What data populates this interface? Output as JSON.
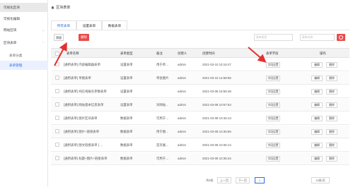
{
  "sidebar": {
    "items": [
      {
        "label": "可视化区块",
        "chevron": "",
        "type": "top",
        "state": "highlight"
      },
      {
        "label": "可视化编辑",
        "chevron": "",
        "type": "top",
        "state": ""
      },
      {
        "label": "网站区块",
        "chevron": "⌄",
        "type": "top",
        "state": ""
      },
      {
        "label": "区块表单",
        "chevron": "⌃",
        "type": "top",
        "state": ""
      },
      {
        "label": "表单分类",
        "chevron": "",
        "type": "sub",
        "state": ""
      },
      {
        "label": "表单管理",
        "chevron": "",
        "type": "sub",
        "state": "active"
      }
    ]
  },
  "breadcrumb": {
    "label": "区块表单"
  },
  "tabs": [
    {
      "label": "所有表单",
      "active": true
    },
    {
      "label": "设置表单",
      "active": false
    },
    {
      "label": "数据表单",
      "active": false
    }
  ],
  "toolbar": {
    "add_label": "添加",
    "delete_label": "删除",
    "filter1_placeholder": "表单类型",
    "filter2_placeholder": "表单名称"
  },
  "table": {
    "headers": [
      "表单名称",
      "表单类型",
      "备注",
      "创建人",
      "创建时间",
      "表单字段",
      "操作"
    ],
    "field_btn": "字段设置",
    "edit_btn": "编辑",
    "del_btn": "删除",
    "rows": [
      {
        "name": "[通用表单] 内容编辑器表单",
        "type": "设置表单",
        "note": "用于单…",
        "creator": "admin",
        "time": "2021-03-10 15:15:47"
      },
      {
        "name": "[通用表单] 单图表单",
        "type": "设置表单",
        "note": "单张图片",
        "creator": "admin",
        "time": "2021-03-10 14:58:55"
      },
      {
        "name": "[通用表单] 纯在线报名参数表单",
        "type": "设置表单",
        "note": "",
        "creator": "admin",
        "time": "2021-03-08 15:56:49"
      },
      {
        "name": "[通用表单] 网站基本信息表单",
        "type": "设置表单",
        "note": "对网站…",
        "creator": "admin",
        "time": "2021-03-08 10:57:54"
      },
      {
        "name": "[通用表单] 图片区块表单",
        "type": "数据表单",
        "note": "可用于…",
        "creator": "admin",
        "time": "2021-03-08 10:46:13"
      },
      {
        "name": "[通用表单] 图片+链接表单",
        "type": "数据表单",
        "note": "用于图…",
        "creator": "admin",
        "time": "2021-03-08 10:36:56"
      },
      {
        "name": "[通用表单] 图文链接表单 [ …",
        "type": "数据表单",
        "note": "首页展…",
        "creator": "admin",
        "time": "2021-03-08 10:36:14"
      },
      {
        "name": "[通用表单] 标题+图片+链接表单",
        "type": "数据表单",
        "note": "可用于…",
        "creator": "admin",
        "time": "2021-03-08 10:35:34"
      }
    ]
  },
  "pager": {
    "total": "共8条",
    "prev": "上一页",
    "next": "下一页",
    "page": "1",
    "page_size": "15条/页"
  },
  "colors": {
    "accent": "#2f6fe0",
    "danger": "#e74c4c",
    "arrow": "#e53030"
  }
}
